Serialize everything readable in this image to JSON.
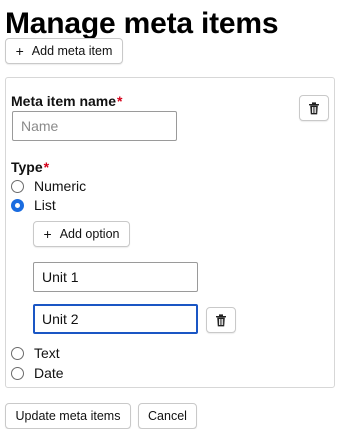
{
  "page": {
    "title": "Manage meta items"
  },
  "toolbar": {
    "add_meta_item_label": "Add meta item",
    "add_icon": "plus-icon"
  },
  "meta_item": {
    "name_label": "Meta item name",
    "required_marker": "*",
    "name_value": "",
    "name_placeholder": "Name",
    "delete_icon": "trash-icon",
    "type_label": "Type",
    "type_options": [
      {
        "label": "Numeric",
        "checked": false
      },
      {
        "label": "List",
        "checked": true
      },
      {
        "label": "Text",
        "checked": false
      },
      {
        "label": "Date",
        "checked": false
      }
    ],
    "add_option_label": "Add option",
    "options": [
      {
        "value": "Unit 1",
        "focused": false
      },
      {
        "value": "Unit 2",
        "focused": true,
        "delete_icon": "trash-icon"
      }
    ]
  },
  "footer": {
    "update_label": "Update meta items",
    "cancel_label": "Cancel"
  },
  "colors": {
    "required": "#d4001a",
    "radio_checked": "#1a6ce0",
    "focus_border": "#1a56c4"
  }
}
